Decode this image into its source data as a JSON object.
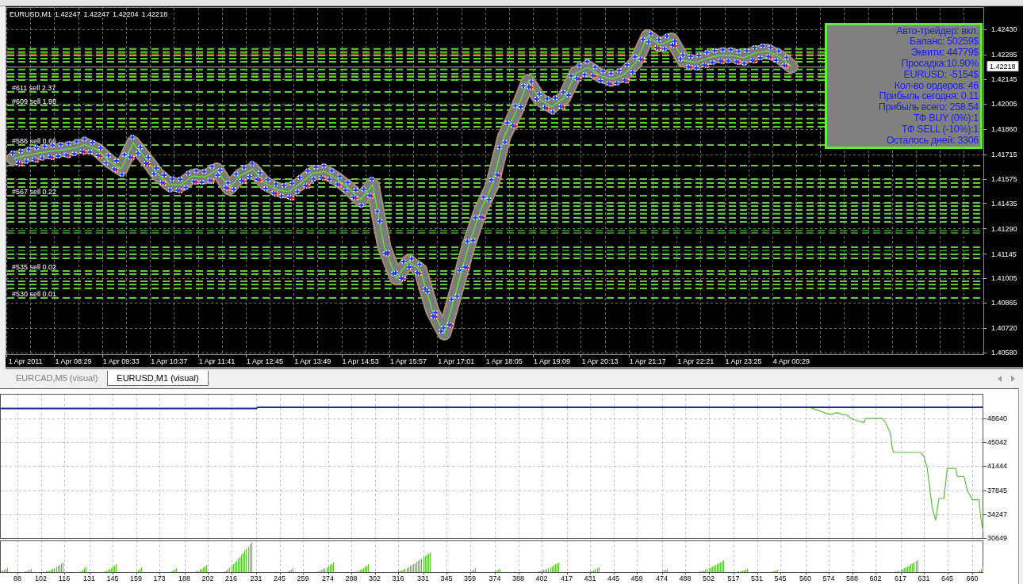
{
  "price_chart": {
    "chart_data": {
      "type": "line",
      "title": "EURUSD,M1 1.42247 1.42247 1.42204 1.42218",
      "grid": true,
      "categories": [
        null,
        "1 Apr 2011",
        null,
        null,
        null,
        "1 Apr 08:29",
        null,
        null,
        null,
        "1 Apr 09:33",
        null,
        null,
        null,
        "1 Apr 10:37",
        null,
        null,
        null,
        "1 Apr 11:41",
        null,
        null,
        null,
        "1 Apr 12:45",
        null,
        null,
        null,
        "1 Apr 13:49",
        null,
        null,
        null,
        "1 Apr 14:53",
        null,
        null,
        null,
        "1 Apr 15:57",
        null,
        null,
        null,
        "1 Apr 17:01",
        null,
        null,
        null,
        "1 Apr 18:05",
        null,
        null,
        null,
        "1 Apr 19:09",
        null,
        null,
        null,
        "1 Apr 20:13",
        null,
        null,
        null,
        "1 Apr 21:17",
        null,
        null,
        null,
        "1 Apr 22:21",
        null,
        null,
        null,
        "1 Apr 23:25",
        null,
        null,
        null,
        "4 Apr 00:29",
        null,
        null,
        null,
        null,
        null,
        null,
        null,
        null,
        null,
        null,
        null,
        null,
        null,
        null,
        null,
        null
      ],
      "series": [
        {
          "color": "#5ee03a",
          "values": [
            1.4169,
            1.41707,
            1.41721,
            1.41731,
            1.41739,
            1.41749,
            1.4177,
            1.4174,
            1.41676,
            1.41631,
            1.4178,
            1.41695,
            1.41604,
            1.41543,
            1.4154,
            1.41591,
            1.41584,
            1.41627,
            1.4152,
            1.41595,
            1.4163,
            1.4155,
            1.41513,
            1.415,
            1.4155,
            1.41606,
            1.41617,
            1.41575,
            1.41522,
            1.41455,
            1.4154,
            1.4118,
            1.41005,
            1.41102,
            1.41053,
            1.4082,
            1.4069,
            1.40935,
            1.41185,
            1.41388,
            1.41537,
            1.41815,
            1.4196,
            1.42133,
            1.42027,
            1.41988,
            1.42037,
            1.4218,
            1.42213,
            1.42166,
            1.42145,
            1.4217,
            1.4224,
            1.4239,
            1.4234,
            1.4237,
            1.42251,
            1.4224,
            1.42265,
            1.42281,
            1.42281,
            1.42267,
            1.42294,
            1.42306,
            1.42273,
            1.42218,
            null,
            null,
            null,
            null,
            null,
            null,
            null,
            null,
            null,
            null,
            null,
            null,
            null,
            null,
            null,
            null
          ]
        }
      ],
      "ylim": [
        1.40571,
        1.42552
      ],
      "yticks": [
        {
          "value": 1.4243,
          "label": "1.42430"
        },
        {
          "value": 1.42285,
          "label": "1.42285"
        },
        {
          "value": 1.42145,
          "label": "1.42145"
        },
        {
          "value": 1.42005,
          "label": "1.42005"
        },
        {
          "value": 1.4186,
          "label": "1.41860"
        },
        {
          "value": 1.41715,
          "label": "1.41715"
        },
        {
          "value": 1.41575,
          "label": "1.41575"
        },
        {
          "value": 1.41435,
          "label": "1.41435"
        },
        {
          "value": 1.4129,
          "label": "1.41290"
        },
        {
          "value": 1.41145,
          "label": "1.41145"
        },
        {
          "value": 1.41005,
          "label": "1.41005"
        },
        {
          "value": 1.40865,
          "label": "1.40865"
        },
        {
          "value": 1.4072,
          "label": "1.40720"
        },
        {
          "value": 1.4058,
          "label": "1.40580"
        }
      ],
      "ref_lines": [
        {
          "axis": "y",
          "value": 1.42317,
          "color": "#5ad12e"
        },
        {
          "axis": "y",
          "value": 1.42299,
          "color": "#5ad12e"
        },
        {
          "axis": "y",
          "value": 1.42289,
          "color": "#b3261e"
        },
        {
          "axis": "y",
          "value": 1.4228,
          "color": "#5ad12e"
        },
        {
          "axis": "y",
          "value": 1.42262,
          "color": "#5ad12e"
        },
        {
          "axis": "y",
          "value": 1.42244,
          "color": "#5ad12e"
        },
        {
          "axis": "y",
          "value": 1.42218,
          "color": "#a8a8a8"
        },
        {
          "axis": "y",
          "value": 1.42199,
          "color": "#5ad12e"
        },
        {
          "axis": "y",
          "value": 1.42176,
          "color": "#5ad12e"
        },
        {
          "axis": "y",
          "value": 1.42163,
          "color": "#b3261e"
        },
        {
          "axis": "y",
          "value": 1.42158,
          "color": "#5ad12e"
        },
        {
          "axis": "y",
          "value": 1.4214,
          "color": "#5ad12e"
        },
        {
          "axis": "y",
          "value": 1.42071,
          "color": "#5ad12e",
          "label": "#611 sell 2.37"
        },
        {
          "axis": "y",
          "value": 1.41994,
          "color": "#5ad12e",
          "label": "#609 sell 1.98"
        },
        {
          "axis": "y",
          "value": 1.41968,
          "color": "#5ad12e"
        },
        {
          "axis": "y",
          "value": 1.41918,
          "color": "#5ad12e"
        },
        {
          "axis": "y",
          "value": 1.41895,
          "color": "#5ad12e"
        },
        {
          "axis": "y",
          "value": 1.41872,
          "color": "#5ad12e"
        },
        {
          "axis": "y",
          "value": 1.41768,
          "color": "#5ad12e",
          "label": "#586 sell 0.66"
        },
        {
          "axis": "y",
          "value": 1.4165,
          "color": "#5ad12e"
        },
        {
          "axis": "y",
          "value": 1.41573,
          "color": "#5ad12e"
        },
        {
          "axis": "y",
          "value": 1.4155,
          "color": "#5ad12e"
        },
        {
          "axis": "y",
          "value": 1.41528,
          "color": "#5ad12e"
        },
        {
          "axis": "y",
          "value": 1.41478,
          "color": "#5ad12e",
          "label": "#567 sell 0.22"
        },
        {
          "axis": "y",
          "value": 1.41437,
          "color": "#5ad12e"
        },
        {
          "axis": "y",
          "value": 1.41419,
          "color": "#5ad12e"
        },
        {
          "axis": "y",
          "value": 1.41396,
          "color": "#5ad12e"
        },
        {
          "axis": "y",
          "value": 1.41374,
          "color": "#5ad12e"
        },
        {
          "axis": "y",
          "value": 1.41351,
          "color": "#5ad12e"
        },
        {
          "axis": "y",
          "value": 1.41328,
          "color": "#5ad12e"
        },
        {
          "axis": "y",
          "value": 1.41278,
          "color": "#2f7d1c"
        },
        {
          "axis": "y",
          "value": 1.41265,
          "color": "#2f7d1c"
        },
        {
          "axis": "y",
          "value": 1.41183,
          "color": "#5ad12e"
        },
        {
          "axis": "y",
          "value": 1.41165,
          "color": "#2f7d1c"
        },
        {
          "axis": "y",
          "value": 1.41142,
          "color": "#5ad12e"
        },
        {
          "axis": "y",
          "value": 1.4112,
          "color": "#5ad12e"
        },
        {
          "axis": "y",
          "value": 1.41047,
          "color": "#5ad12e",
          "label": "#535 sell 0.02"
        },
        {
          "axis": "y",
          "value": 1.41029,
          "color": "#5ad12e"
        },
        {
          "axis": "y",
          "value": 1.40988,
          "color": "#5ad12e"
        },
        {
          "axis": "y",
          "value": 1.4097,
          "color": "#5ad12e"
        },
        {
          "axis": "y",
          "value": 1.40947,
          "color": "#5ad12e"
        },
        {
          "axis": "y",
          "value": 1.40893,
          "color": "#5ad12e",
          "label": "#530 sell 0.01"
        }
      ],
      "annotations": [
        "1.42218"
      ]
    }
  },
  "info_panel": {
    "lines": [
      "Авто-трейдер: вкл.",
      "Баланс: 50259$",
      "Эквити: 44779$",
      "Просадка:10.90%",
      "EURUSD: -5154$",
      "Кол-во ордеров: 46",
      "Прибыль сегодня: 0.11",
      "Прибыль всего: 258.54",
      "ТФ BUY (0%):1",
      "ТФ SELL (-10%):1",
      "Осталось дней: 3306"
    ]
  },
  "tabs": [
    {
      "label": "EURCAD,M5 (visual)",
      "selected": false
    },
    {
      "label": "EURUSD,M1 (visual)",
      "selected": true
    }
  ],
  "equity_chart": {
    "chart_data": {
      "type": "line",
      "grid": true,
      "x": [
        78,
        231,
        232,
        513,
        514,
        562,
        569,
        572,
        575,
        579,
        582,
        585,
        588,
        592,
        595,
        596,
        606,
        608,
        611,
        612,
        613,
        629,
        631,
        633,
        636,
        638,
        640,
        643,
        645,
        650,
        651,
        655,
        657,
        660,
        664,
        665,
        666.5
      ],
      "series": [
        {
          "color": "#1f2a99",
          "values": [
            50100,
            50100,
            50300,
            50300,
            50300,
            50300,
            50300,
            50300,
            50300,
            50300,
            50300,
            50300,
            50300,
            50300,
            50300,
            50300,
            50300,
            50300,
            50300,
            50300,
            50300,
            50300,
            50300,
            50300,
            50300,
            50300,
            50300,
            50300,
            50300,
            50300,
            50300,
            50300,
            50300,
            50300,
            50300,
            50300,
            50300
          ]
        },
        {
          "color": "#5cbf3a",
          "values": [
            null,
            null,
            null,
            null,
            null,
            50300,
            49700,
            49400,
            49200,
            49500,
            49200,
            49100,
            48500,
            48200,
            48000,
            48600,
            48600,
            48000,
            46300,
            44100,
            43500,
            43500,
            42900,
            41100,
            35200,
            33300,
            36600,
            36600,
            41100,
            41100,
            39900,
            39900,
            37800,
            36400,
            36400,
            33800,
            31600
          ]
        }
      ],
      "xlim": [
        77.5,
        666.6
      ],
      "ylim": [
        30649,
        52309
      ],
      "xticks": [
        88,
        102,
        116,
        131,
        145,
        159,
        173,
        188,
        202,
        216,
        231,
        245,
        259,
        274,
        288,
        302,
        316,
        331,
        345,
        359,
        374,
        388,
        402,
        417,
        431,
        445,
        459,
        474,
        488,
        502,
        517,
        531,
        545,
        560,
        574,
        588,
        602,
        617,
        631,
        645,
        660
      ],
      "yticks": [
        48640,
        45042,
        41444,
        37845,
        34247,
        30649
      ]
    }
  }
}
